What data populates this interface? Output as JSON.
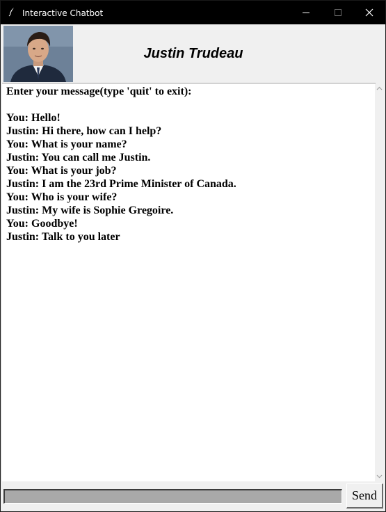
{
  "window": {
    "title": "Interactive Chatbot",
    "app_icon": "feather-icon"
  },
  "header": {
    "bot_name": "Justin Trudeau",
    "avatar": "portrait-photo"
  },
  "chat": {
    "prompt": "Enter your message(type 'quit' to exit):",
    "messages": [
      "You: Hello!",
      "Justin: Hi there, how can I help?",
      "You: What is your name?",
      "Justin: You can call me Justin.",
      "You: What is your job?",
      "Justin: I am the 23rd Prime Minister of Canada.",
      "You: Who is your wife?",
      "Justin: My wife is Sophie Gregoire.",
      "You: Goodbye!",
      "Justin: Talk to you later"
    ]
  },
  "input": {
    "value": ""
  },
  "send_button": {
    "label": "Send"
  },
  "colors": {
    "titlebar": "#000000",
    "background": "#f0f0f0",
    "chat_background": "#ffffff",
    "entry_background": "#a9a9a9"
  }
}
